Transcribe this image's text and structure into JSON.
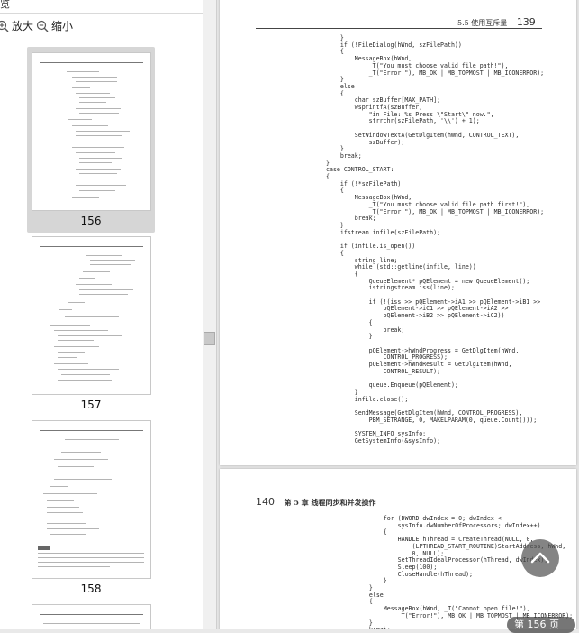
{
  "panel": {
    "title": "览",
    "close": "×"
  },
  "toolbar": {
    "zoom_in": "放大",
    "zoom_out": "缩小"
  },
  "thumbnails": [
    {
      "label": "156",
      "selected": true
    },
    {
      "label": "157",
      "selected": false
    },
    {
      "label": "158",
      "selected": false
    },
    {
      "label": "",
      "selected": false
    }
  ],
  "page139": {
    "header": "5.5 使用互斥量",
    "page_number": "139",
    "code": "    }\n    if (!FileDialog(hWnd, szFilePath))\n    {\n        MessageBox(hWnd,\n            _T(\"You must choose valid file path!\"),\n            _T(\"Error!\"), MB_OK | MB_TOPMOST | MB_ICONERROR);\n    }\n    else\n    {\n        char szBuffer[MAX_PATH];\n        wsprintfA(szBuffer,\n            \"in File: %s Press \\\"Start\\\" now.\",\n            strrchr(szFilePath, '\\\\') + 1);\n\n        SetWindowTextA(GetDlgItem(hWnd, CONTROL_TEXT),\n            szBuffer);\n    }\n    break;\n}\ncase CONTROL_START:\n{\n    if (!*szFilePath)\n    {\n        MessageBox(hWnd,\n            _T(\"You must choose valid file path first!\"),\n            _T(\"Error!\"), MB_OK | MB_TOPMOST | MB_ICONERROR);\n        break;\n    }\n    ifstream infile(szFilePath);\n\n    if (infile.is_open())\n    {\n        string line;\n        while (std::getline(infile, line))\n        {\n            QueueElement* pQElement = new QueueElement();\n            istringstream iss(line);\n\n            if (!(iss >> pQElement->iA1 >> pQElement->iB1 >>\n                pQElement->iC1 >> pQElement->iA2 >>\n                pQElement->iB2 >> pQElement->iC2))\n            {\n                break;\n            }\n\n            pQElement->hWndProgress = GetDlgItem(hWnd,\n                CONTROL_PROGRESS);\n            pQElement->hWndResult = GetDlgItem(hWnd,\n                CONTROL_RESULT);\n\n            queue.Enqueue(pQElement);\n        }\n        infile.close();\n\n        SendMessage(GetDlgItem(hWnd, CONTROL_PROGRESS),\n            PBM_SETRANGE, 0, MAKELPARAM(0, queue.Count()));\n\n        SYSTEM_INFO sysInfo;\n        GetSystemInfo(&sysInfo);"
  },
  "page140": {
    "page_number": "140",
    "header": "第 5 章  线程同步和并发操作",
    "code": "        for (DWORD dwIndex = 0; dwIndex <\n            sysInfo.dwNumberOfProcessors; dwIndex++)\n        {\n            HANDLE hThread = CreateThread(NULL, 0,\n                (LPTHREAD_START_ROUTINE)StartAddress, hWnd,\n                0, NULL);\n            SetThreadIdealProcessor(hThread, dwIndex);\n            Sleep(100);\n            CloseHandle(hThread);\n        }\n    }\n    else\n    {\n        MessageBox(hWnd, _T(\"Cannot open file!\"),\n            _T(\"Error!\"), MB_OK | MB_TOPMOST | MB_ICONERROR);\n    }\n    break;"
  },
  "overlay": {
    "page_indicator": "第 156 页"
  }
}
